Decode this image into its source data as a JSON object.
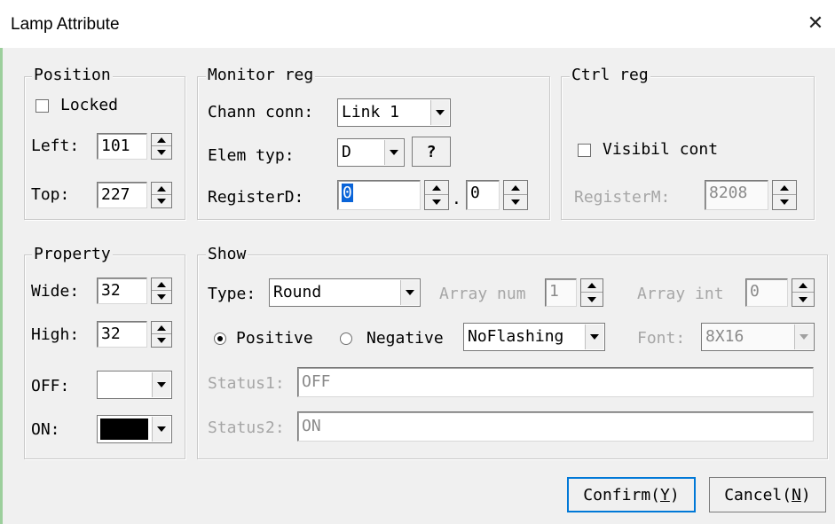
{
  "window": {
    "title": "Lamp Attribute",
    "close_icon": "close-icon"
  },
  "position": {
    "legend": "Position",
    "locked_label": "Locked",
    "left_label": "Left:",
    "left_value": "101",
    "top_label": "Top:",
    "top_value": "227"
  },
  "monitor": {
    "legend": "Monitor reg",
    "chann_label": "Chann conn:",
    "chann_value": "Link 1",
    "elem_label": "Elem typ:",
    "elem_value": "D",
    "help_label": "?",
    "register_label": "RegisterD:",
    "register_value": "0",
    "register_dot": ".",
    "register_bit": "0"
  },
  "ctrl": {
    "legend": "Ctrl reg",
    "visibil_label": "Visibil cont",
    "register_label": "RegisterM:",
    "register_value": "8208"
  },
  "property": {
    "legend": "Property",
    "wide_label": "Wide:",
    "wide_value": "32",
    "high_label": "High:",
    "high_value": "32",
    "off_label": "OFF:",
    "off_color": "#ffffff",
    "on_label": "ON:",
    "on_color": "#000000"
  },
  "show": {
    "legend": "Show",
    "type_label": "Type:",
    "type_value": "Round",
    "array_num_label": "Array num",
    "array_num_value": "1",
    "array_int_label": "Array int",
    "array_int_value": "0",
    "positive_label": "Positive",
    "negative_label": "Negative",
    "flash_value": "NoFlashing",
    "font_label": "Font:",
    "font_value": "8X16",
    "status1_label": "Status1:",
    "status1_value": "OFF",
    "status2_label": "Status2:",
    "status2_value": "ON"
  },
  "buttons": {
    "confirm_label": "Confirm(",
    "confirm_key": "Y",
    "confirm_end": ")",
    "cancel_label": "Cancel(",
    "cancel_key": "N",
    "cancel_end": ")"
  }
}
